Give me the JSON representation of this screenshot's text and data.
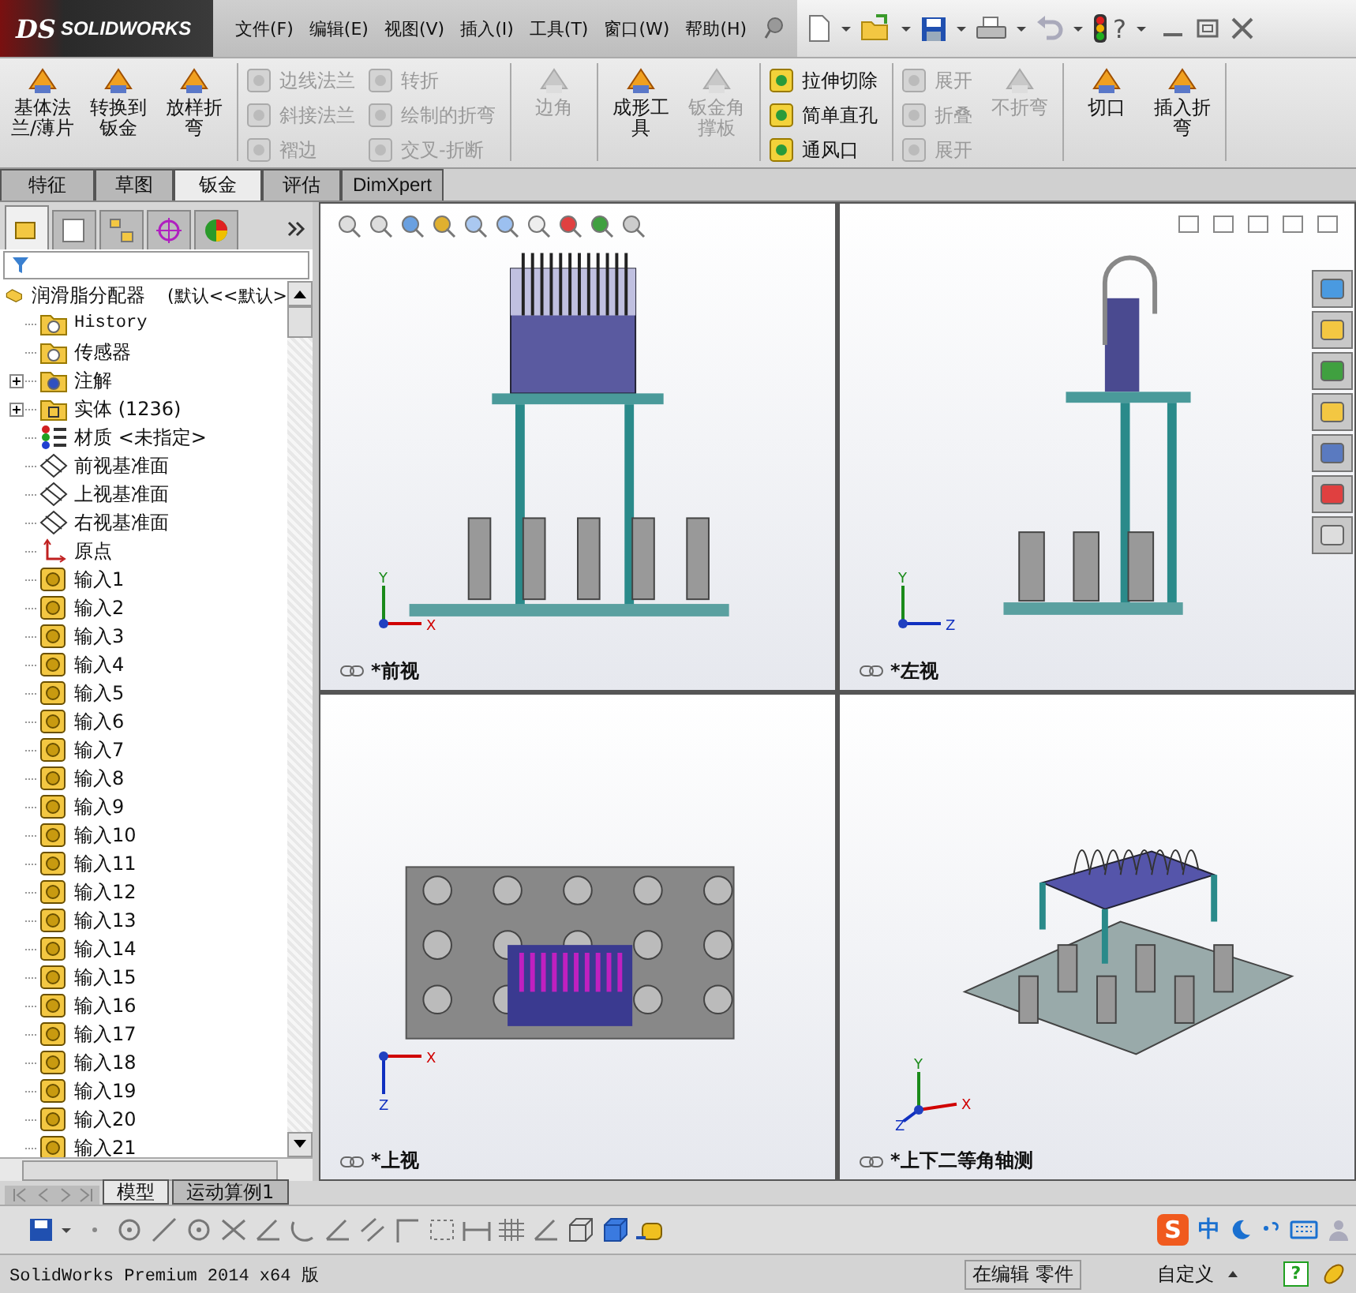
{
  "window": {
    "logo_mark": "DS",
    "logo": "SOLIDWORKS",
    "help": "?"
  },
  "menu": [
    {
      "label": "文件(F)"
    },
    {
      "label": "编辑(E)"
    },
    {
      "label": "视图(V)"
    },
    {
      "label": "插入(I)"
    },
    {
      "label": "工具(T)"
    },
    {
      "label": "窗口(W)"
    },
    {
      "label": "帮助(H)"
    }
  ],
  "ribbon": {
    "groups": [
      {
        "items": [
          {
            "label": "基体法兰/薄片",
            "kind": "large",
            "disabled": false
          },
          {
            "label": "转换到钣金",
            "kind": "large",
            "disabled": false
          },
          {
            "label": "放样折弯",
            "kind": "large",
            "disabled": false
          }
        ]
      },
      {
        "items": [
          {
            "label": "边线法兰",
            "kind": "small",
            "disabled": true
          },
          {
            "label": "斜接法兰",
            "kind": "small",
            "disabled": true
          },
          {
            "label": "褶边",
            "kind": "small",
            "disabled": true
          },
          {
            "label": "转折",
            "kind": "small",
            "disabled": true
          },
          {
            "label": "绘制的折弯",
            "kind": "small",
            "disabled": true
          },
          {
            "label": "交叉-折断",
            "kind": "small",
            "disabled": true
          }
        ]
      },
      {
        "items": [
          {
            "label": "边角",
            "kind": "large",
            "disabled": true
          }
        ]
      },
      {
        "items": [
          {
            "label": "成形工具",
            "kind": "large",
            "disabled": false
          },
          {
            "label": "钣金角撑板",
            "kind": "large",
            "disabled": true
          }
        ]
      },
      {
        "items": [
          {
            "label": "拉伸切除",
            "kind": "small",
            "disabled": false
          },
          {
            "label": "简单直孔",
            "kind": "small",
            "disabled": false
          },
          {
            "label": "通风口",
            "kind": "small",
            "disabled": false
          }
        ]
      },
      {
        "items": [
          {
            "label": "展开",
            "kind": "small",
            "disabled": true
          },
          {
            "label": "折叠",
            "kind": "small",
            "disabled": true
          },
          {
            "label": "展开",
            "kind": "small",
            "disabled": true
          },
          {
            "label": "不折弯",
            "kind": "large",
            "disabled": true
          }
        ]
      },
      {
        "items": [
          {
            "label": "切口",
            "kind": "large",
            "disabled": false
          },
          {
            "label": "插入折弯",
            "kind": "large",
            "disabled": false
          }
        ]
      }
    ]
  },
  "tabs": [
    {
      "label": "特征",
      "selected": false
    },
    {
      "label": "草图",
      "selected": false
    },
    {
      "label": "钣金",
      "selected": true
    },
    {
      "label": "评估",
      "selected": false
    },
    {
      "label": "DimXpert",
      "selected": false
    }
  ],
  "feature_manager": {
    "panel_tabs": [
      {
        "selected": true
      },
      {
        "selected": false
      },
      {
        "selected": false
      },
      {
        "selected": false
      },
      {
        "selected": false
      }
    ],
    "root": {
      "name": "润滑脂分配器",
      "config": "(默认<<默认>"
    },
    "items": [
      {
        "label": "History",
        "kind": "history"
      },
      {
        "label": "传感器",
        "kind": "sensor"
      },
      {
        "label": "注解",
        "kind": "annotation",
        "expanded": false
      },
      {
        "label": "实体 (1236)",
        "kind": "solid",
        "expanded": false
      },
      {
        "label": "材质 <未指定>",
        "kind": "material"
      },
      {
        "label": "前视基准面",
        "kind": "plane"
      },
      {
        "label": "上视基准面",
        "kind": "plane"
      },
      {
        "label": "右视基准面",
        "kind": "plane"
      },
      {
        "label": "原点",
        "kind": "origin"
      },
      {
        "label": "输入1",
        "kind": "import"
      },
      {
        "label": "输入2",
        "kind": "import"
      },
      {
        "label": "输入3",
        "kind": "import"
      },
      {
        "label": "输入4",
        "kind": "import"
      },
      {
        "label": "输入5",
        "kind": "import"
      },
      {
        "label": "输入6",
        "kind": "import"
      },
      {
        "label": "输入7",
        "kind": "import"
      },
      {
        "label": "输入8",
        "kind": "import"
      },
      {
        "label": "输入9",
        "kind": "import"
      },
      {
        "label": "输入10",
        "kind": "import"
      },
      {
        "label": "输入11",
        "kind": "import"
      },
      {
        "label": "输入12",
        "kind": "import"
      },
      {
        "label": "输入13",
        "kind": "import"
      },
      {
        "label": "输入14",
        "kind": "import"
      },
      {
        "label": "输入15",
        "kind": "import"
      },
      {
        "label": "输入16",
        "kind": "import"
      },
      {
        "label": "输入17",
        "kind": "import"
      },
      {
        "label": "输入18",
        "kind": "import"
      },
      {
        "label": "输入19",
        "kind": "import"
      },
      {
        "label": "输入20",
        "kind": "import"
      },
      {
        "label": "输入21",
        "kind": "import"
      }
    ]
  },
  "viewports": [
    {
      "kind": "front",
      "label": "*前视",
      "axes": [
        "Y",
        "X"
      ]
    },
    {
      "kind": "side",
      "label": "*左视",
      "axes": [
        "Y",
        "Z"
      ]
    },
    {
      "kind": "top",
      "label": "*上视",
      "axes": [
        "X",
        "Z"
      ]
    },
    {
      "kind": "iso",
      "label": "*上下二等角轴测",
      "axes": [
        "Y",
        "X",
        "Z"
      ]
    }
  ],
  "bottom_tabs": [
    {
      "label": "模型",
      "selected": true
    },
    {
      "label": "运动算例1",
      "selected": false
    }
  ],
  "ime": {
    "logo": "S",
    "mode": "中"
  },
  "status_bar": {
    "app": "SolidWorks Premium 2014 x64 版",
    "mode": "在编辑 零件",
    "units": "自定义",
    "help": "?"
  }
}
